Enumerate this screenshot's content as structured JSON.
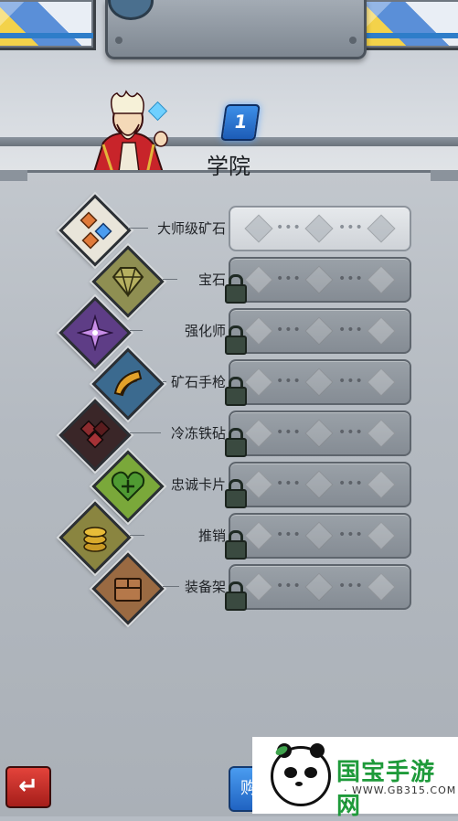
{
  "header": {
    "level": "1",
    "title": "学院"
  },
  "tree": {
    "rows": [
      {
        "label": "大师级矿石",
        "icon": "ore-quad-icon",
        "locked": false,
        "active": true
      },
      {
        "label": "宝石",
        "icon": "gem-icon",
        "locked": true,
        "active": false
      },
      {
        "label": "强化师",
        "icon": "compass-star-icon",
        "locked": true,
        "active": false
      },
      {
        "label": "矿石手枪",
        "icon": "ore-pistol-icon",
        "locked": true,
        "active": false
      },
      {
        "label": "冷冻铁砧",
        "icon": "frozen-anvil-icon",
        "locked": true,
        "active": false
      },
      {
        "label": "忠诚卡片",
        "icon": "heart-card-icon",
        "locked": true,
        "active": false
      },
      {
        "label": "推销",
        "icon": "coin-stack-icon",
        "locked": true,
        "active": false
      },
      {
        "label": "装备架",
        "icon": "equipment-rack-icon",
        "locked": true,
        "active": false
      }
    ]
  },
  "footer": {
    "back_icon": "return-arrow-icon",
    "buy_label": "购"
  },
  "watermark": {
    "brand": "国宝手游网",
    "url": "· WWW.GB315.COM ·"
  },
  "colors": {
    "panel": "#b6bcc4",
    "accent_blue": "#2f7fd8",
    "back_red": "#c92a24",
    "watermark_green": "#1e9a3a"
  }
}
